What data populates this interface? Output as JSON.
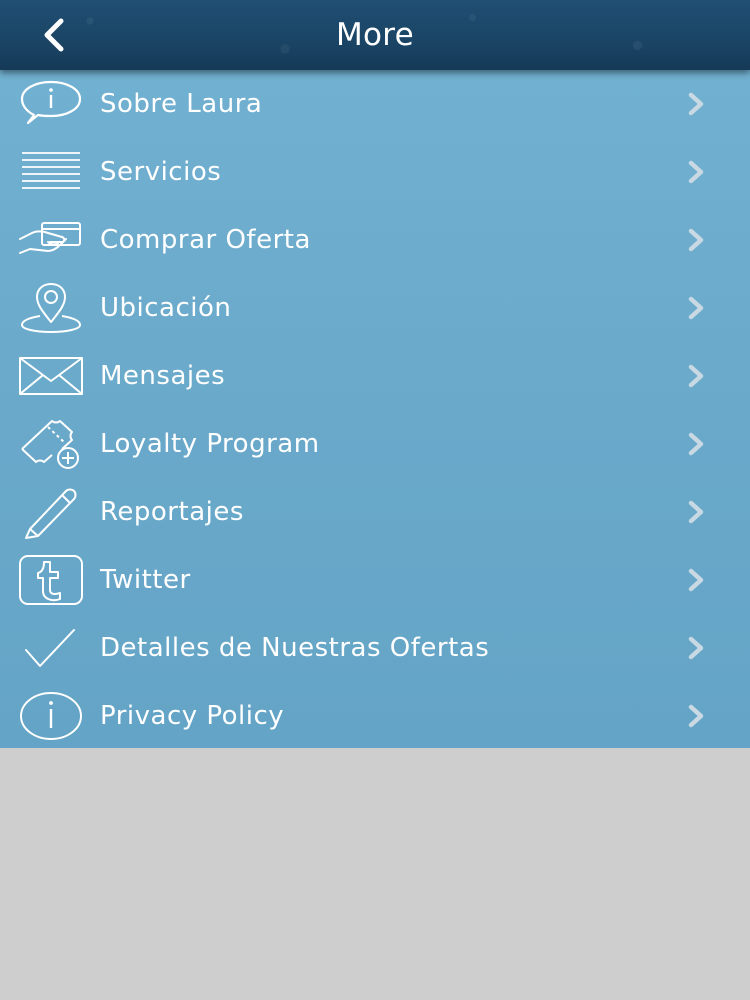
{
  "header": {
    "title": "More",
    "back_icon": "chevron-left-icon"
  },
  "colors": {
    "header_bg": "#1b4566",
    "menu_bg": "#6aa9ca",
    "bottom_bg": "#cecece",
    "text": "#ffffff",
    "chevron": "#c9d9e4"
  },
  "menu": {
    "items": [
      {
        "label": "Sobre Laura",
        "icon": "info-speech-bubble-icon"
      },
      {
        "label": "Servicios",
        "icon": "list-lines-icon"
      },
      {
        "label": "Comprar Oferta",
        "icon": "hand-card-icon"
      },
      {
        "label": "Ubicación",
        "icon": "map-pin-icon"
      },
      {
        "label": "Mensajes",
        "icon": "envelope-icon"
      },
      {
        "label": "Loyalty Program",
        "icon": "ticket-plus-icon"
      },
      {
        "label": "Reportajes",
        "icon": "pencil-icon"
      },
      {
        "label": "Twitter",
        "icon": "tumblr-t-icon"
      },
      {
        "label": "Detalles de Nuestras Ofertas",
        "icon": "checkmark-icon"
      },
      {
        "label": "Privacy Policy",
        "icon": "info-circle-icon"
      }
    ]
  }
}
